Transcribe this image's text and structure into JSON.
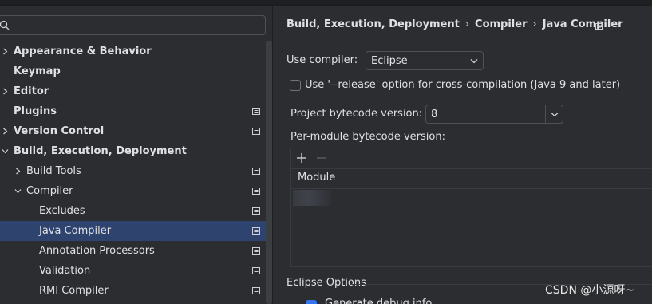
{
  "sidebar": {
    "search_placeholder": "",
    "items": [
      {
        "label": "Appearance & Behavior",
        "level": 0,
        "expandable": true,
        "expanded": false,
        "bold": true,
        "project_icon": false,
        "selected": false
      },
      {
        "label": "Keymap",
        "level": 0,
        "expandable": false,
        "expanded": false,
        "bold": true,
        "project_icon": false,
        "selected": false
      },
      {
        "label": "Editor",
        "level": 0,
        "expandable": true,
        "expanded": false,
        "bold": true,
        "project_icon": false,
        "selected": false
      },
      {
        "label": "Plugins",
        "level": 0,
        "expandable": false,
        "expanded": false,
        "bold": true,
        "project_icon": true,
        "selected": false
      },
      {
        "label": "Version Control",
        "level": 0,
        "expandable": true,
        "expanded": false,
        "bold": true,
        "project_icon": true,
        "selected": false
      },
      {
        "label": "Build, Execution, Deployment",
        "level": 0,
        "expandable": true,
        "expanded": true,
        "bold": true,
        "project_icon": false,
        "selected": false
      },
      {
        "label": "Build Tools",
        "level": 1,
        "expandable": true,
        "expanded": false,
        "bold": false,
        "project_icon": true,
        "selected": false
      },
      {
        "label": "Compiler",
        "level": 1,
        "expandable": true,
        "expanded": true,
        "bold": false,
        "project_icon": true,
        "selected": false
      },
      {
        "label": "Excludes",
        "level": 2,
        "expandable": false,
        "expanded": false,
        "bold": false,
        "project_icon": true,
        "selected": false
      },
      {
        "label": "Java Compiler",
        "level": 2,
        "expandable": false,
        "expanded": false,
        "bold": false,
        "project_icon": true,
        "selected": true
      },
      {
        "label": "Annotation Processors",
        "level": 2,
        "expandable": false,
        "expanded": false,
        "bold": false,
        "project_icon": true,
        "selected": false
      },
      {
        "label": "Validation",
        "level": 2,
        "expandable": false,
        "expanded": false,
        "bold": false,
        "project_icon": true,
        "selected": false
      },
      {
        "label": "RMI Compiler",
        "level": 2,
        "expandable": false,
        "expanded": false,
        "bold": false,
        "project_icon": true,
        "selected": false
      }
    ]
  },
  "breadcrumb": {
    "items": [
      "Build, Execution, Deployment",
      "Compiler",
      "Java Compiler"
    ],
    "separator": "›"
  },
  "form": {
    "use_compiler_label": "Use compiler:",
    "use_compiler_value": "Eclipse",
    "release_option_label": "Use '--release' option for cross-compilation (Java 9 and later)",
    "release_option_checked": false,
    "bytecode_label": "Project bytecode version:",
    "bytecode_value": "8",
    "per_module_label": "Per-module bytecode version:",
    "module_column": "Module",
    "eclipse_options_label": "Eclipse Options",
    "eclipse_checkbox_label": "Generate debug info"
  },
  "watermark": "CSDN @小源呀~",
  "colors": {
    "background": "#2b2d30",
    "selection": "#2e436e",
    "text": "#dfe1e5",
    "accent": "#3574f0"
  }
}
